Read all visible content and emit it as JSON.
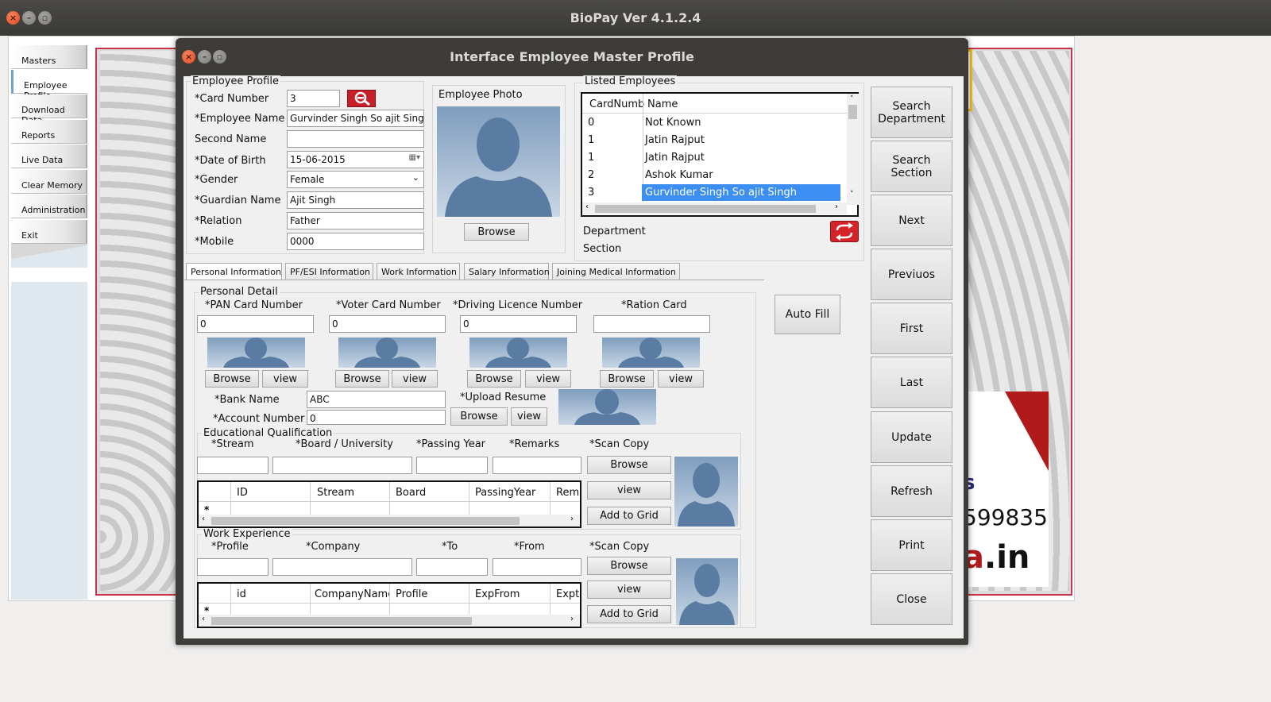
{
  "app": {
    "title": "BioPay Ver 4.1.2.4"
  },
  "sidebar": {
    "items": [
      {
        "label": "Masters"
      },
      {
        "label": "Employee Profile"
      },
      {
        "label": "Download Data"
      },
      {
        "label": "Reports"
      },
      {
        "label": "Live Data"
      },
      {
        "label": "Clear Memory"
      },
      {
        "label": "Administration"
      },
      {
        "label": "Exit"
      }
    ]
  },
  "banner": {
    "s": "s",
    "phone": "599835",
    "in_red": "a",
    "in": ".in"
  },
  "dialog": {
    "title": "Interface Employee Master Profile"
  },
  "profile": {
    "group_title": "Employee Profile",
    "card_number_label": "*Card Number",
    "card_number": "3",
    "employee_name_label": "*Employee Name",
    "employee_name": "Gurvinder Singh So ajit Singh",
    "second_name_label": "Second Name",
    "second_name": "",
    "dob_label": "*Date of Birth",
    "dob": "15-06-2015",
    "gender_label": "*Gender",
    "gender": "Female",
    "guardian_label": "*Guardian Name",
    "guardian": "Ajit Singh",
    "relation_label": "*Relation",
    "relation": "Father",
    "mobile_label": "*Mobile",
    "mobile": "0000"
  },
  "photo": {
    "title": "Employee Photo",
    "browse": "Browse"
  },
  "listed": {
    "title": "Listed Employees",
    "columns": [
      "CardNumb",
      "Name"
    ],
    "rows": [
      {
        "card": "0",
        "name": "Not Known"
      },
      {
        "card": "1",
        "name": "Jatin Rajput"
      },
      {
        "card": "1",
        "name": "Jatin Rajput"
      },
      {
        "card": "2",
        "name": "Ashok Kumar"
      },
      {
        "card": "3",
        "name": "Gurvinder Singh So ajit Singh"
      }
    ],
    "department_label": "Department",
    "section_label": "Section"
  },
  "right_buttons": [
    "Search Department",
    "Search Section",
    "Next",
    "Previuos",
    "First",
    "Last",
    "Update",
    "Refresh",
    "Print",
    "Close"
  ],
  "tabs": [
    "Personal Information",
    "PF/ESI Information",
    "Work Information",
    "Salary Information",
    "Joining Medical Information"
  ],
  "personal": {
    "group_title": "Personal Detail",
    "pan_label": "*PAN Card Number",
    "pan": "0",
    "voter_label": "*Voter Card Number",
    "voter": "0",
    "dl_label": "*Driving Licence Number",
    "dl": "0",
    "ration_label": "*Ration Card",
    "ration": "",
    "browse": "Browse",
    "view": "view",
    "bank_label": "*Bank Name",
    "bank": "ABC",
    "account_label": "*Account Number",
    "account": "0",
    "resume_label": "*Upload Resume",
    "autofill": "Auto Fill"
  },
  "education": {
    "group_title": "Educational Qualification",
    "stream_label": "*Stream",
    "board_label": "*Board / University",
    "year_label": "*Passing Year",
    "remarks_label": "*Remarks",
    "scan_label": "*Scan Copy",
    "browse": "Browse",
    "view": "view",
    "add": "Add to Grid",
    "columns": [
      "ID",
      "Stream",
      "Board",
      "PassingYear",
      "Rema"
    ]
  },
  "work": {
    "group_title": "Work Experience",
    "profile_label": "*Profile",
    "company_label": "*Company",
    "to_label": "*To",
    "from_label": "*From",
    "scan_label": "*Scan Copy",
    "browse": "Browse",
    "view": "view",
    "add": "Add to Grid",
    "columns": [
      "id",
      "CompanyName",
      "Profile",
      "ExpFrom",
      "Expto"
    ]
  },
  "grid_new_row_marker": "*",
  "colors": {
    "accent_select": "#3c8ff0",
    "titlebar": "#3d3c39",
    "close_button": "#e0461f",
    "banner_red": "#b11a1a"
  }
}
